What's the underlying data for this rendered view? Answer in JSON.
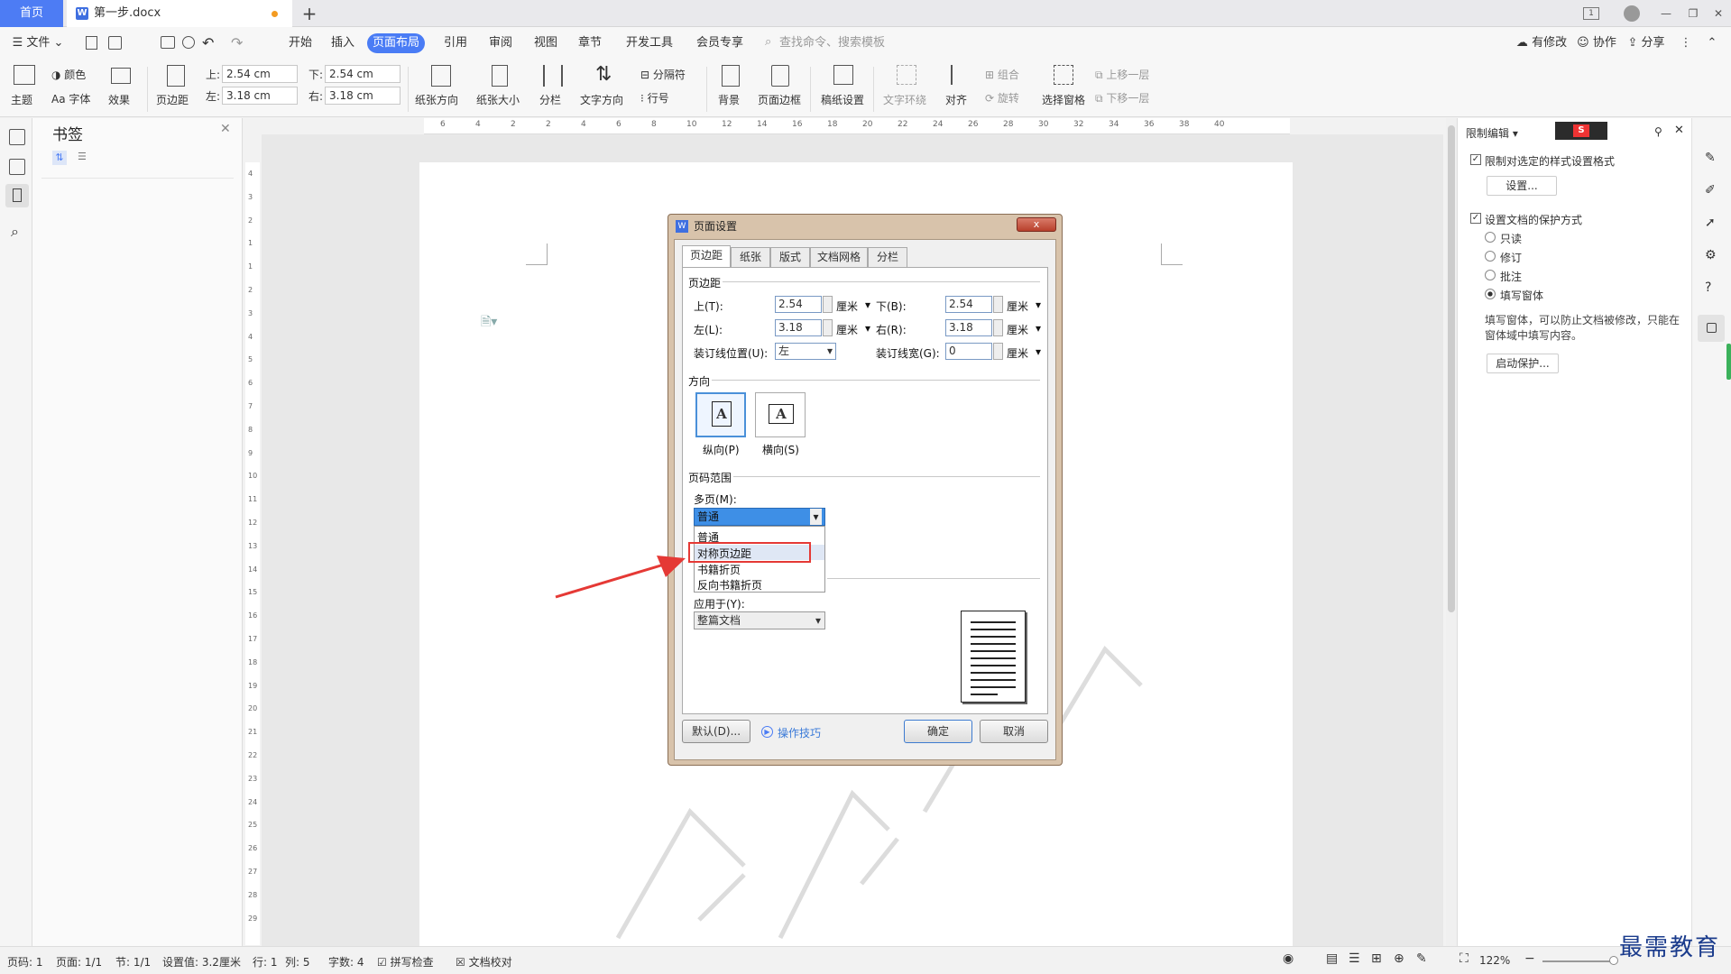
{
  "titlebar": {
    "home_tab": "首页",
    "doc_tab": "第一步.docx",
    "new_tab": "+"
  },
  "menu": {
    "file": "文件",
    "items": [
      "开始",
      "插入",
      "页面布局",
      "引用",
      "审阅",
      "视图",
      "章节",
      "开发工具",
      "会员专享"
    ],
    "active_index": 2,
    "search_placeholder": "查找命令、搜索模板",
    "right": [
      "有修改",
      "协作",
      "分享"
    ]
  },
  "ribbon": {
    "theme": "主题",
    "color": "颜色",
    "font": "Aa 字体",
    "effect": "效果",
    "margins": "页边距",
    "top_label": "上:",
    "top_val": "2.54 cm",
    "left_label": "左:",
    "left_val": "3.18 cm",
    "bottom_label": "下:",
    "bottom_val": "2.54 cm",
    "right_label": "右:",
    "right_val": "3.18 cm",
    "orientation": "纸张方向",
    "size": "纸张大小",
    "columns": "分栏",
    "text_dir": "文字方向",
    "separator": "分隔符",
    "line_no": "行号",
    "background": "背景",
    "page_border": "页面边框",
    "draft": "稿纸设置",
    "text_wrap": "文字环绕",
    "align": "对齐",
    "group": "组合",
    "rotate": "旋转",
    "select_pane": "选择窗格",
    "up_layer": "上移一层",
    "down_layer": "下移一层"
  },
  "bookmark_panel": {
    "title": "书签"
  },
  "right_panel": {
    "title": "限制编辑",
    "opt1": "限制对选定的样式设置格式",
    "settings_btn": "设置...",
    "opt2": "设置文档的保护方式",
    "radios": [
      "只读",
      "修订",
      "批注",
      "填写窗体"
    ],
    "selected_radio": 3,
    "desc": "填写窗体，可以防止文档被修改，只能在窗体域中填写内容。",
    "start_btn": "启动保护..."
  },
  "ruler": {
    "h_ticks": [
      "6",
      "4",
      "2",
      "2",
      "4",
      "6",
      "8",
      "10",
      "12",
      "14",
      "16",
      "18",
      "20",
      "22",
      "24",
      "26",
      "28",
      "30",
      "32",
      "34",
      "36",
      "38",
      "40"
    ],
    "v_ticks": [
      "4",
      "3",
      "2",
      "1",
      "1",
      "2",
      "3",
      "4",
      "5",
      "6",
      "7",
      "8",
      "9",
      "10",
      "11",
      "12",
      "13",
      "14",
      "15",
      "16",
      "17",
      "18",
      "19",
      "20",
      "21",
      "22",
      "23",
      "24",
      "25",
      "26",
      "27",
      "28",
      "29"
    ]
  },
  "dialog": {
    "title": "页面设置",
    "close": "x",
    "tabs": [
      "页边距",
      "纸张",
      "版式",
      "文档网格",
      "分栏"
    ],
    "section_margins": "页边距",
    "top": "上(T):",
    "top_val": "2.54",
    "bottom": "下(B):",
    "bottom_val": "2.54",
    "left": "左(L):",
    "left_val": "3.18",
    "right": "右(R):",
    "right_val": "3.18",
    "unit": "厘米",
    "gutter_pos": "装订线位置(U):",
    "gutter_pos_val": "左",
    "gutter_w": "装订线宽(G):",
    "gutter_w_val": "0",
    "section_orient": "方向",
    "portrait": "纵向(P)",
    "landscape": "横向(S)",
    "section_pages": "页码范围",
    "multi": "多页(M):",
    "multi_val": "普通",
    "options": [
      "普通",
      "对称页边距",
      "书籍折页",
      "反向书籍折页"
    ],
    "highlighted_option": 1,
    "apply_to": "应用于(Y):",
    "apply_val": "整篇文档",
    "default_btn": "默认(D)...",
    "tips": "操作技巧",
    "ok": "确定",
    "cancel": "取消"
  },
  "status": {
    "page": "页码: 1",
    "pages": "页面: 1/1",
    "section": "节: 1/1",
    "setting": "设置值: 3.2厘米",
    "row": "行: 1",
    "col": "列: 5",
    "words": "字数: 4",
    "spell": "拼写检查",
    "proof": "文档校对",
    "zoom": "122%"
  },
  "watermark": "最需教育"
}
